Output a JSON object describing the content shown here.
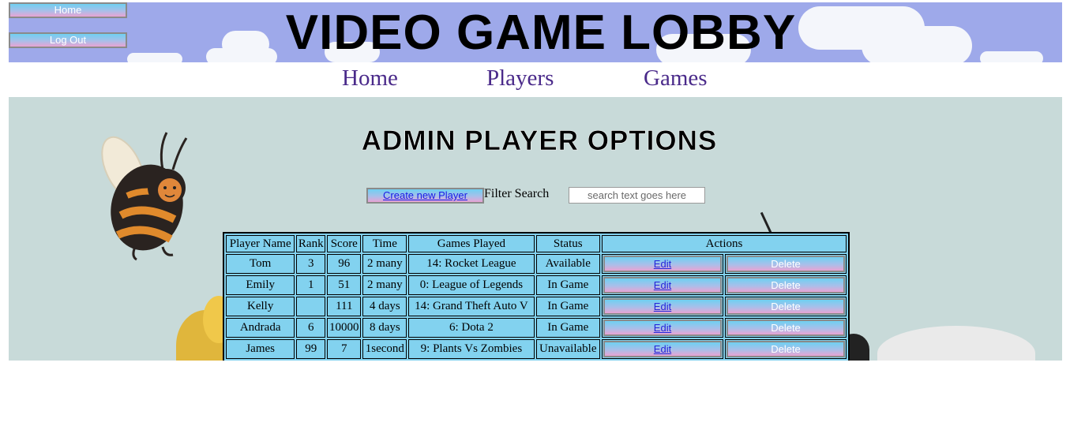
{
  "header": {
    "title": "VIDEO GAME LOBBY",
    "home_button": "Home",
    "logout_button": "Log Out",
    "bg_color": "#9ea9ea"
  },
  "nav": {
    "home": "Home",
    "players": "Players",
    "games": "Games"
  },
  "main": {
    "heading": "ADMIN PLAYER OPTIONS",
    "create_button": "Create new Player",
    "filter_label": "Filter Search",
    "search_placeholder": "search text goes here"
  },
  "table": {
    "headers": [
      "Player Name",
      "Rank",
      "Score",
      "Time",
      "Games Played",
      "Status",
      "Actions"
    ],
    "rows": [
      {
        "name": "Tom",
        "rank": "3",
        "score": "96",
        "time": "2 many",
        "games": "14: Rocket League",
        "status": "Available"
      },
      {
        "name": "Emily",
        "rank": "1",
        "score": "51",
        "time": "2 many",
        "games": "0: League of Legends",
        "status": "In Game"
      },
      {
        "name": "Kelly",
        "rank": "",
        "score": "111",
        "time": "4 days",
        "games": "14: Grand Theft Auto V",
        "status": "In Game"
      },
      {
        "name": "Andrada",
        "rank": "6",
        "score": "10000",
        "time": "8 days",
        "games": "6: Dota 2",
        "status": "In Game"
      },
      {
        "name": "James",
        "rank": "99",
        "score": "7",
        "time": "1second",
        "games": "9: Plants Vs Zombies",
        "status": "Unavailable"
      }
    ],
    "edit_label": "Edit",
    "delete_label": "Delete"
  },
  "colors": {
    "table_bg": "#82d2ef",
    "nav_link": "#4a2a8a",
    "main_bg": "#c8dad9"
  }
}
